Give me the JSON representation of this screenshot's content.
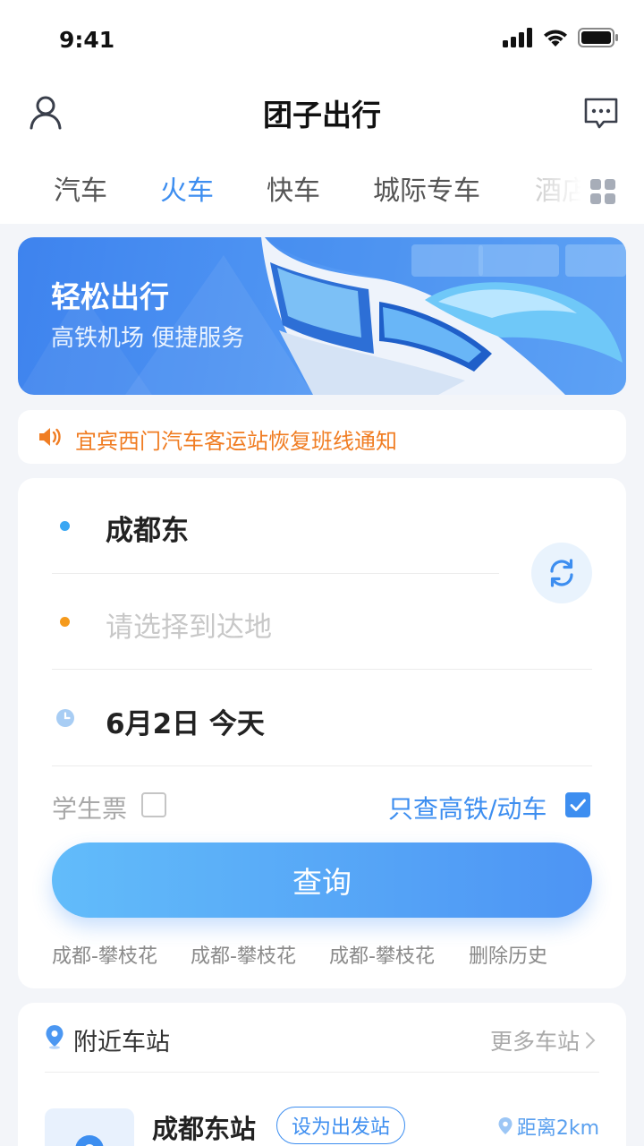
{
  "status_bar": {
    "time": "9:41"
  },
  "header": {
    "title": "团子出行"
  },
  "tabs": [
    {
      "label": "汽车"
    },
    {
      "label": "火车"
    },
    {
      "label": "快车"
    },
    {
      "label": "城际专车"
    },
    {
      "label": "酒店"
    }
  ],
  "banner": {
    "title": "轻松出行",
    "subtitle": "高铁机场 便捷服务"
  },
  "notice": {
    "text": "宜宾西门汽车客运站恢复班线通知"
  },
  "search": {
    "origin": "成都东",
    "destination_placeholder": "请选择到达地",
    "date": "6月2日 今天",
    "student_ticket_label": "学生票",
    "high_speed_only_label": "只查高铁/动车",
    "search_button": "查询",
    "history": [
      "成都-攀枝花",
      "成都-攀枝花",
      "成都-攀枝花"
    ],
    "clear_history": "删除历史"
  },
  "nearby": {
    "title": "附近车站",
    "more": "更多车站",
    "station_name": "成都东站",
    "set_origin": "设为出发站",
    "distance": "距离2km"
  },
  "colors": {
    "accent": "#3d8ef0",
    "notice": "#f07d23",
    "origin_dot": "#3aa7f3",
    "destination_dot": "#f59a1c"
  },
  "icons": {
    "profile": "user-icon",
    "messages": "message-icon",
    "more_categories": "grid-icon",
    "notice": "speaker-icon",
    "swap": "swap-icon",
    "date": "clock-icon",
    "location": "location-pin-icon"
  }
}
